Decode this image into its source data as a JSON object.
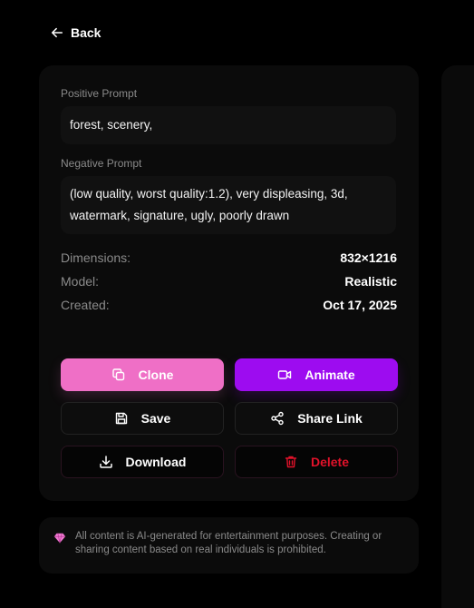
{
  "nav": {
    "back_label": "Back"
  },
  "prompts": {
    "positive_label": "Positive Prompt",
    "positive_value": "forest, scenery,",
    "negative_label": "Negative Prompt",
    "negative_value": "(low quality, worst quality:1.2), very displeasing, 3d, watermark, signature, ugly, poorly drawn"
  },
  "info": [
    {
      "key": "Dimensions:",
      "value": "832×1216"
    },
    {
      "key": "Model:",
      "value": "Realistic"
    },
    {
      "key": "Created:",
      "value": "Oct 17, 2025"
    }
  ],
  "actions": {
    "clone": "Clone",
    "animate": "Animate",
    "save": "Save",
    "share": "Share Link",
    "download": "Download",
    "delete": "Delete"
  },
  "notice": {
    "text": "All content is AI-generated for entertainment purposes. Creating or sharing content based on real individuals is prohibited."
  },
  "colors": {
    "clone": "#ef6fc6",
    "animate": "#9d0cf0",
    "delete": "#e1122a",
    "gem": "#f07ad2"
  },
  "icons": {
    "back": "arrow-left-icon",
    "clone": "copy-icon",
    "animate": "video-icon",
    "save": "save-icon",
    "share": "share-icon",
    "download": "download-icon",
    "delete": "trash-icon",
    "notice": "gem-icon"
  }
}
